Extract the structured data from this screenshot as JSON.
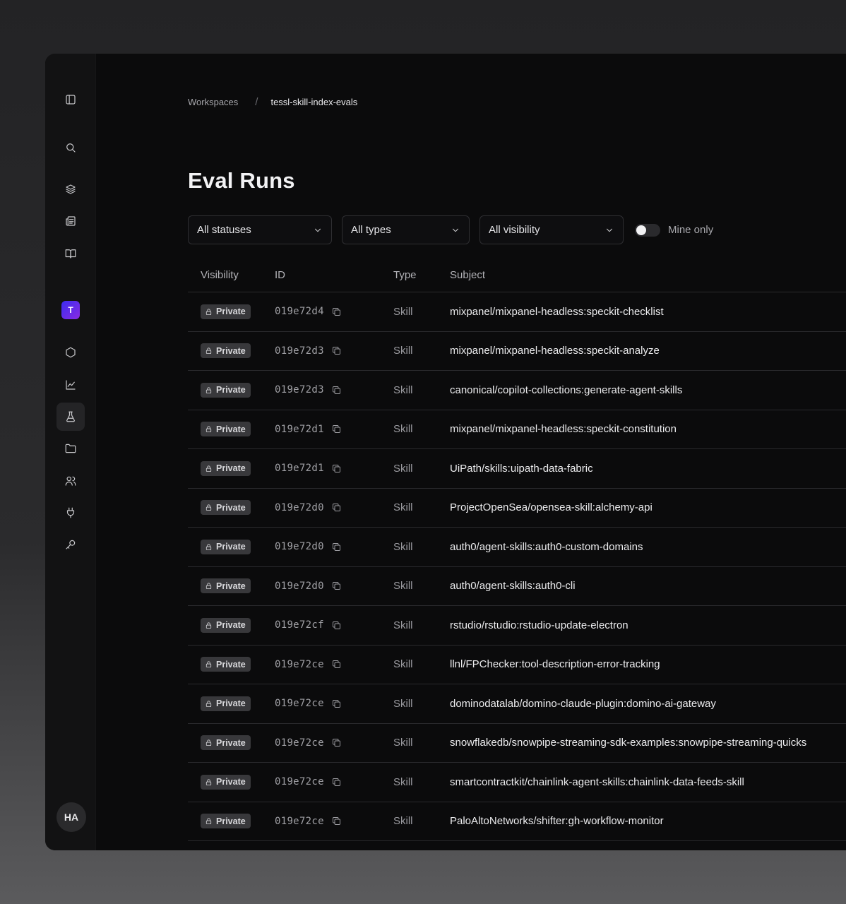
{
  "breadcrumb": {
    "parent": "Workspaces",
    "separator": "/",
    "current": "tessl-skill-index-evals"
  },
  "sidebar": {
    "workspace_initial": "T",
    "user_initials": "HA",
    "icons": [
      "sidebar-toggle-icon",
      "search-icon",
      "layers-icon",
      "newspaper-icon",
      "book-icon",
      "hexagon-icon",
      "chart-icon",
      "flask-icon",
      "folder-icon",
      "users-icon",
      "plug-icon",
      "key-icon"
    ],
    "active_item": "flask-icon"
  },
  "page": {
    "title": "Eval Runs"
  },
  "filters": {
    "status": "All statuses",
    "type": "All types",
    "visibility": "All visibility",
    "mine_only_label": "Mine only",
    "mine_only_on": false
  },
  "table": {
    "headers": {
      "visibility": "Visibility",
      "id": "ID",
      "type": "Type",
      "subject": "Subject"
    },
    "rows": [
      {
        "visibility": "Private",
        "id": "019e72d4",
        "type": "Skill",
        "subject": "mixpanel/mixpanel-headless:speckit-checklist"
      },
      {
        "visibility": "Private",
        "id": "019e72d3",
        "type": "Skill",
        "subject": "mixpanel/mixpanel-headless:speckit-analyze"
      },
      {
        "visibility": "Private",
        "id": "019e72d3",
        "type": "Skill",
        "subject": "canonical/copilot-collections:generate-agent-skills"
      },
      {
        "visibility": "Private",
        "id": "019e72d1",
        "type": "Skill",
        "subject": "mixpanel/mixpanel-headless:speckit-constitution"
      },
      {
        "visibility": "Private",
        "id": "019e72d1",
        "type": "Skill",
        "subject": "UiPath/skills:uipath-data-fabric"
      },
      {
        "visibility": "Private",
        "id": "019e72d0",
        "type": "Skill",
        "subject": "ProjectOpenSea/opensea-skill:alchemy-api"
      },
      {
        "visibility": "Private",
        "id": "019e72d0",
        "type": "Skill",
        "subject": "auth0/agent-skills:auth0-custom-domains"
      },
      {
        "visibility": "Private",
        "id": "019e72d0",
        "type": "Skill",
        "subject": "auth0/agent-skills:auth0-cli"
      },
      {
        "visibility": "Private",
        "id": "019e72cf",
        "type": "Skill",
        "subject": "rstudio/rstudio:rstudio-update-electron"
      },
      {
        "visibility": "Private",
        "id": "019e72ce",
        "type": "Skill",
        "subject": "llnl/FPChecker:tool-description-error-tracking"
      },
      {
        "visibility": "Private",
        "id": "019e72ce",
        "type": "Skill",
        "subject": "dominodatalab/domino-claude-plugin:domino-ai-gateway"
      },
      {
        "visibility": "Private",
        "id": "019e72ce",
        "type": "Skill",
        "subject": "snowflakedb/snowpipe-streaming-sdk-examples:snowpipe-streaming-quicks"
      },
      {
        "visibility": "Private",
        "id": "019e72ce",
        "type": "Skill",
        "subject": "smartcontractkit/chainlink-agent-skills:chainlink-data-feeds-skill"
      },
      {
        "visibility": "Private",
        "id": "019e72ce",
        "type": "Skill",
        "subject": "PaloAltoNetworks/shifter:gh-workflow-monitor"
      }
    ]
  }
}
